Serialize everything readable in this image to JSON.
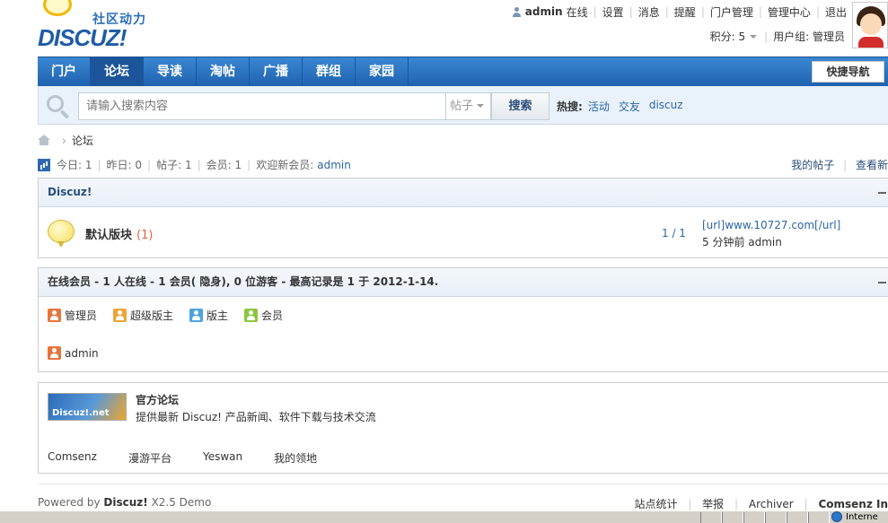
{
  "logo": {
    "tagline": "社区动力",
    "text": "DISCUZ!"
  },
  "usermenu": {
    "username": "admin",
    "online_status": "在线",
    "items": [
      "设置",
      "消息",
      "提醒",
      "门户管理",
      "管理中心",
      "退出"
    ],
    "points_label": "积分: 5",
    "usergroup_label": "用户组: 管理员"
  },
  "nav": {
    "items": [
      "门户",
      "论坛",
      "导读",
      "淘帖",
      "广播",
      "群组",
      "家园"
    ],
    "active": "论坛",
    "quicknav_label": "快捷导航"
  },
  "search": {
    "placeholder": "请输入搜索内容",
    "type_value": "帖子",
    "button_label": "搜索",
    "hot_label": "热搜:",
    "hot_links": [
      "活动",
      "交友",
      "discuz"
    ]
  },
  "breadcrumb": {
    "current": "论坛"
  },
  "stats": {
    "today": "今日: 1",
    "yesterday": "昨日: 0",
    "posts": "帖子: 1",
    "members": "会员: 1",
    "welcome_label": "欢迎新会员:",
    "newest_member": "admin",
    "my_posts_link": "我的帖子",
    "view_new_link": "查看新"
  },
  "forum_panel": {
    "category": "Discuz!",
    "forum_name": "默认版块",
    "forum_today_count": "(1)",
    "ratio": "1 / 1",
    "last_post_title": "[url]www.10727.com[/url]",
    "last_post_meta": "5 分钟前 admin"
  },
  "online_panel": {
    "title": "在线会员 - 1 人在线 - 1 会员( 隐身), 0 位游客 - 最高记录是 1 于 2012-1-14.",
    "roles": [
      {
        "label": "管理员",
        "color": "#e8743b"
      },
      {
        "label": "超级版主",
        "color": "#f0a33a"
      },
      {
        "label": "版主",
        "color": "#4ba3e0"
      },
      {
        "label": "会员",
        "color": "#8cc63f"
      }
    ],
    "online_users": [
      "admin"
    ]
  },
  "links_panel": {
    "logo_text": "Discuz!.net",
    "official_title": "官方论坛",
    "official_desc": "提供最新 Discuz! 产品新闻、软件下载与技术交流",
    "links": [
      "Comsenz",
      "漫游平台",
      "Yeswan",
      "我的领地"
    ]
  },
  "footer": {
    "powered_by": "Powered by",
    "product": "Discuz!",
    "version": "X2.5 Demo",
    "right_links": [
      "站点统计",
      "举报",
      "Archiver",
      "Comsenz In"
    ]
  },
  "statusbar": {
    "zone": "Interne"
  },
  "colors": {
    "nav_bg": "#2a72c2",
    "link": "#2b66a5",
    "accent_count": "#e0613a"
  }
}
